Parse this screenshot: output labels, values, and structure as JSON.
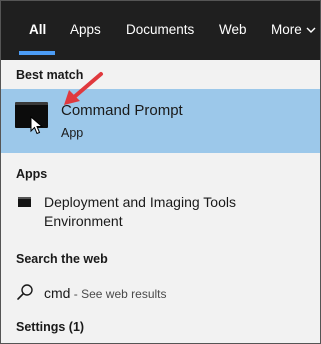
{
  "tabs": [
    {
      "label": "All",
      "active": true
    },
    {
      "label": "Apps"
    },
    {
      "label": "Documents"
    },
    {
      "label": "Web"
    },
    {
      "label": "More"
    }
  ],
  "best_match": {
    "header": "Best match",
    "title": "Command Prompt",
    "subtitle": "App",
    "icon": "command-prompt-icon"
  },
  "apps": {
    "header": "Apps",
    "items": [
      {
        "title": "Deployment and Imaging Tools Environment",
        "icon": "command-prompt-icon"
      }
    ]
  },
  "web": {
    "header": "Search the web",
    "query": "cmd",
    "suffix": " - See web results",
    "icon": "search-icon"
  },
  "settings": {
    "header": "Settings (1)"
  },
  "colors": {
    "tabbar_bg": "#1f1f1f",
    "accent": "#4c9cf5",
    "selected_bg": "#9cc8ea",
    "annotation_arrow": "#e0393e"
  }
}
